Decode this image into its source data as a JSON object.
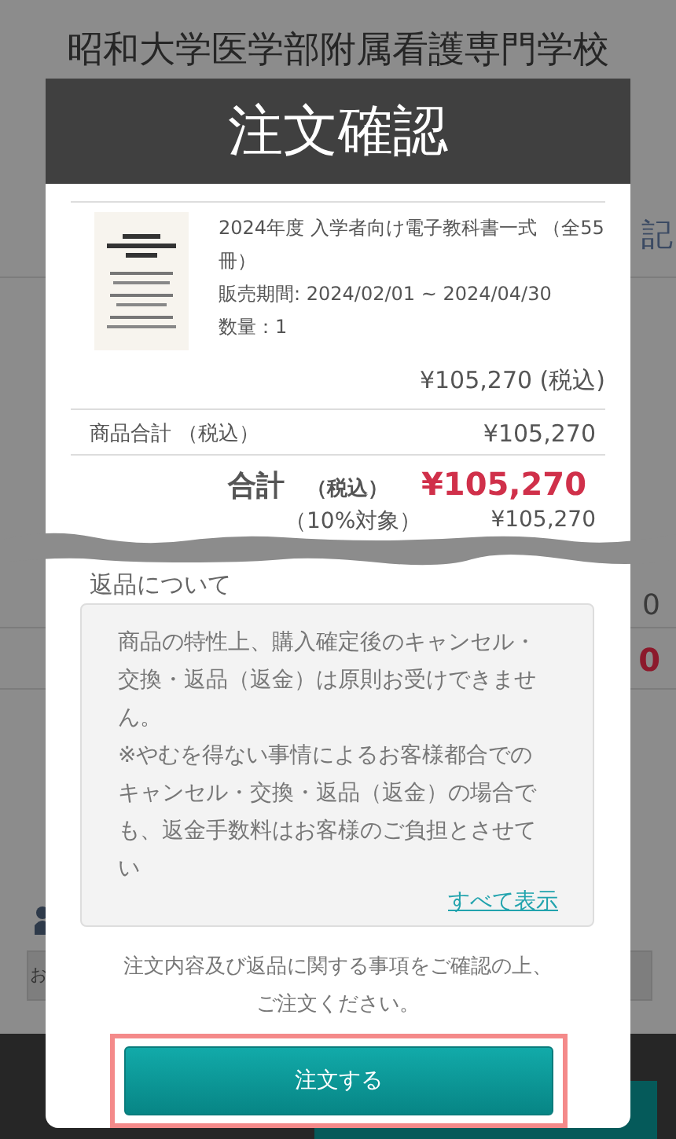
{
  "school_name": "昭和大学医学部附属看護専門学校",
  "background_texts": [
    {
      "text": "記",
      "kind": "link"
    },
    {
      "text": "0",
      "kind": "amount"
    },
    {
      "text": "0",
      "kind": "total"
    },
    {
      "text": "お",
      "kind": "field"
    }
  ],
  "dialog": {
    "title": "注文確認",
    "item": {
      "name": "2024年度 入学者向け電子教科書一式 （全55冊）",
      "sale_period": "販売期間: 2024/02/01 ~ 2024/04/30",
      "quantity": "数量：1",
      "price": "¥105,270 (税込)"
    },
    "subtotal": {
      "label": "商品合計 （税込）",
      "value": "¥105,270"
    },
    "total": {
      "label": "合計",
      "tax_note": "（税込）",
      "value": "¥105,270"
    },
    "tax_rows": [
      {
        "label": "（10%対象）",
        "value": "¥105,270"
      }
    ],
    "returns": {
      "heading": "返品について",
      "paragraphs": [
        "商品の特性上、購入確定後のキャンセル・交換・返品（返金）は原則お受けできません。",
        "※やむを得ない事情によるお客様都合でのキャンセル・交換・返品（返金）の場合でも、返金手数料はお客様のご負担とさせてい"
      ],
      "show_all": "すべて表示"
    },
    "notice": "注文内容及び返品に関する事項をご確認の上、ご注文ください。",
    "order_button": {
      "label": "注文する",
      "highlighted": true
    }
  }
}
